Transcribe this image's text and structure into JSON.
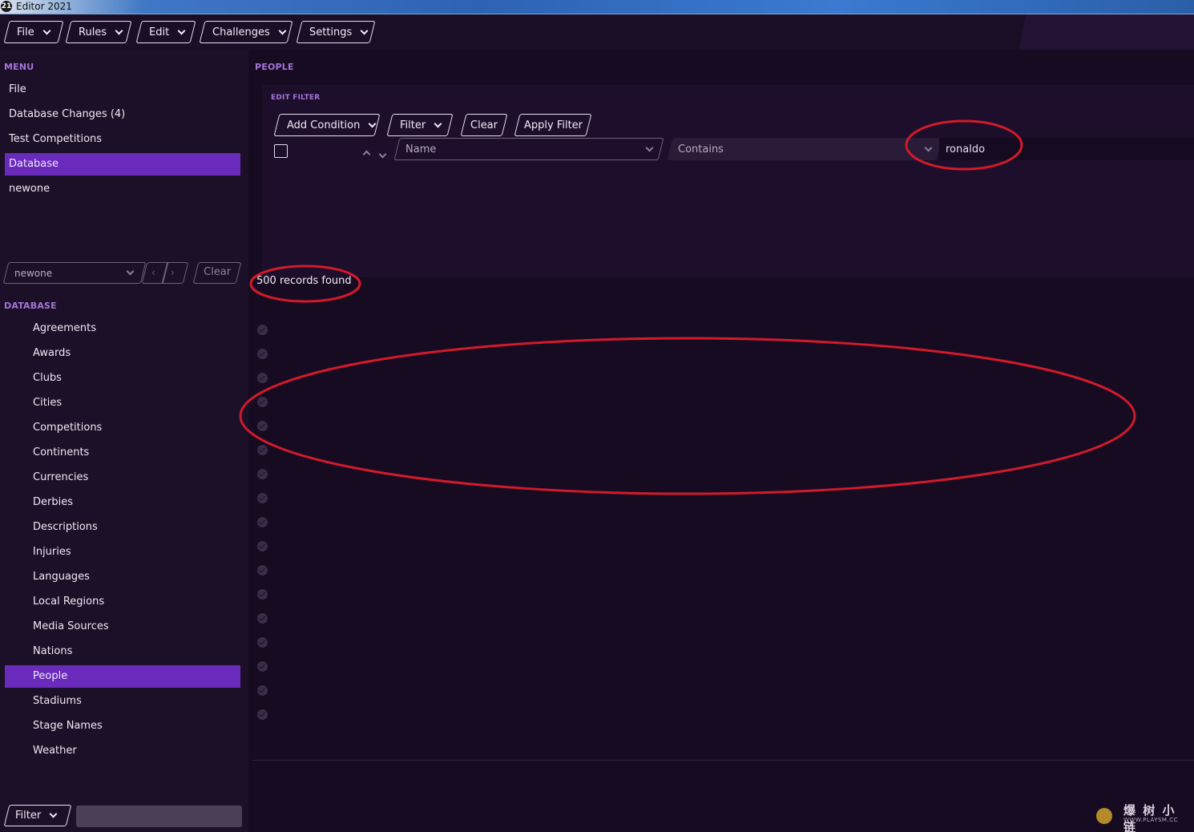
{
  "window": {
    "title": "Editor 2021",
    "logo": "21"
  },
  "topmenu": {
    "items": [
      {
        "label": "File"
      },
      {
        "label": "Rules"
      },
      {
        "label": "Edit"
      },
      {
        "label": "Challenges"
      },
      {
        "label": "Settings"
      }
    ]
  },
  "sidebar": {
    "menu_label": "MENU",
    "menu_items": [
      "File",
      "Database Changes (4)",
      "Test Competitions",
      "Database",
      "newone"
    ],
    "active_menu": "Database",
    "selector": {
      "value": "newone",
      "clear_label": "Clear"
    },
    "database_label": "DATABASE",
    "db_items": [
      "Agreements",
      "Awards",
      "Clubs",
      "Cities",
      "Competitions",
      "Continents",
      "Currencies",
      "Derbies",
      "Descriptions",
      "Injuries",
      "Languages",
      "Local Regions",
      "Media Sources",
      "Nations",
      "People",
      "Stadiums",
      "Stage Names",
      "Weather"
    ],
    "active_db": "People",
    "bottom_filter_label": "Filter"
  },
  "main": {
    "section_title": "PEOPLE",
    "edit_filter_label": "EDIT FILTER",
    "buttons": {
      "add_condition": "Add Condition",
      "filter": "Filter",
      "clear": "Clear",
      "apply_filter": "Apply Filter"
    },
    "condition": {
      "field": "Name",
      "operator": "Contains",
      "value": "ronaldo"
    },
    "records_found": "500 records found"
  },
  "watermark": {
    "text": "爆 树 小 链",
    "sub": "WWW.PLAYSM.CC"
  },
  "colors": {
    "accent": "#6a2bbd",
    "section_label": "#a474d8",
    "annotation": "#d21a2a",
    "background": "#1a0e26"
  }
}
